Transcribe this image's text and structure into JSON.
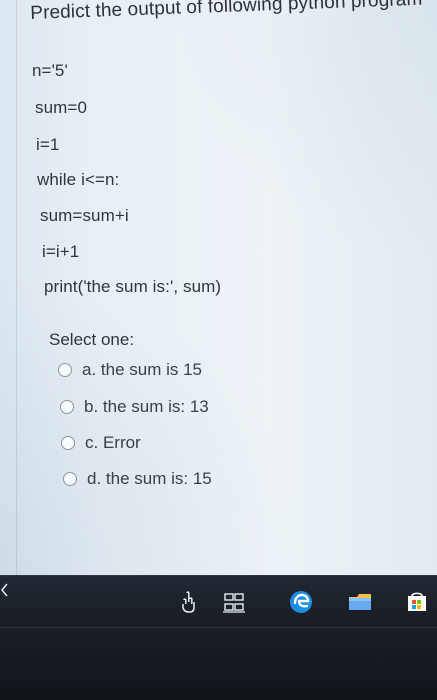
{
  "quiz": {
    "question": "Predict the output of following python program",
    "code_lines": [
      "n='5'",
      "sum=0",
      "i=1",
      "while i<=n:",
      "sum=sum+i",
      "i=i+1",
      "print('the sum is:', sum)"
    ],
    "select_label": "Select one:",
    "options": [
      "a. the sum is 15",
      "b. the sum is: 13",
      "c. Error",
      "d. the sum is: 15"
    ]
  },
  "taskbar": {
    "icons": [
      "touch-icon",
      "task-view-icon",
      "edge-icon",
      "file-explorer-icon",
      "store-icon"
    ],
    "accent_color": "#1d8fe3"
  }
}
